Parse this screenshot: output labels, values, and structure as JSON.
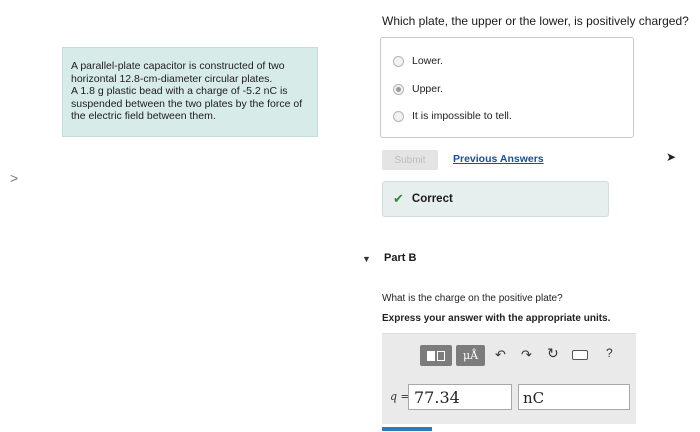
{
  "problem": {
    "lines": [
      "A parallel-plate capacitor is constructed of two",
      "horizontal 12.8-cm-diameter circular plates.",
      "A 1.8 g plastic bead with a charge of -5.2 nC is",
      "suspended between the two plates by the force of",
      "the electric field between them."
    ]
  },
  "icons": {
    "left_chevron": ">",
    "cursor": "➤",
    "check": "✔",
    "part_toggle": "▼",
    "undo": "↶",
    "redo": "↷",
    "reset": "↻",
    "help": "?"
  },
  "part_a": {
    "question": "Which plate, the upper or the lower, is positively charged?",
    "choices": [
      {
        "label": "Lower.",
        "selected": false
      },
      {
        "label": "Upper.",
        "selected": true
      },
      {
        "label": "It is impossible to tell.",
        "selected": false
      }
    ],
    "submit_label": "Submit",
    "previous_answers_label": "Previous Answers",
    "feedback": "Correct"
  },
  "part_b": {
    "title": "Part B",
    "question": "What is the charge on the positive plate?",
    "instruction": "Express your answer with the appropriate units.",
    "units_button_label": "μÅ",
    "variable_label": "q =",
    "value": "77.34",
    "units": "nC"
  },
  "colors": {
    "problem_bg": "#d7ebe9",
    "link": "#1c4f92",
    "check": "#2f8a2f",
    "toolbar_button": "#7c7c7c",
    "accent": "#2a7ac0"
  }
}
